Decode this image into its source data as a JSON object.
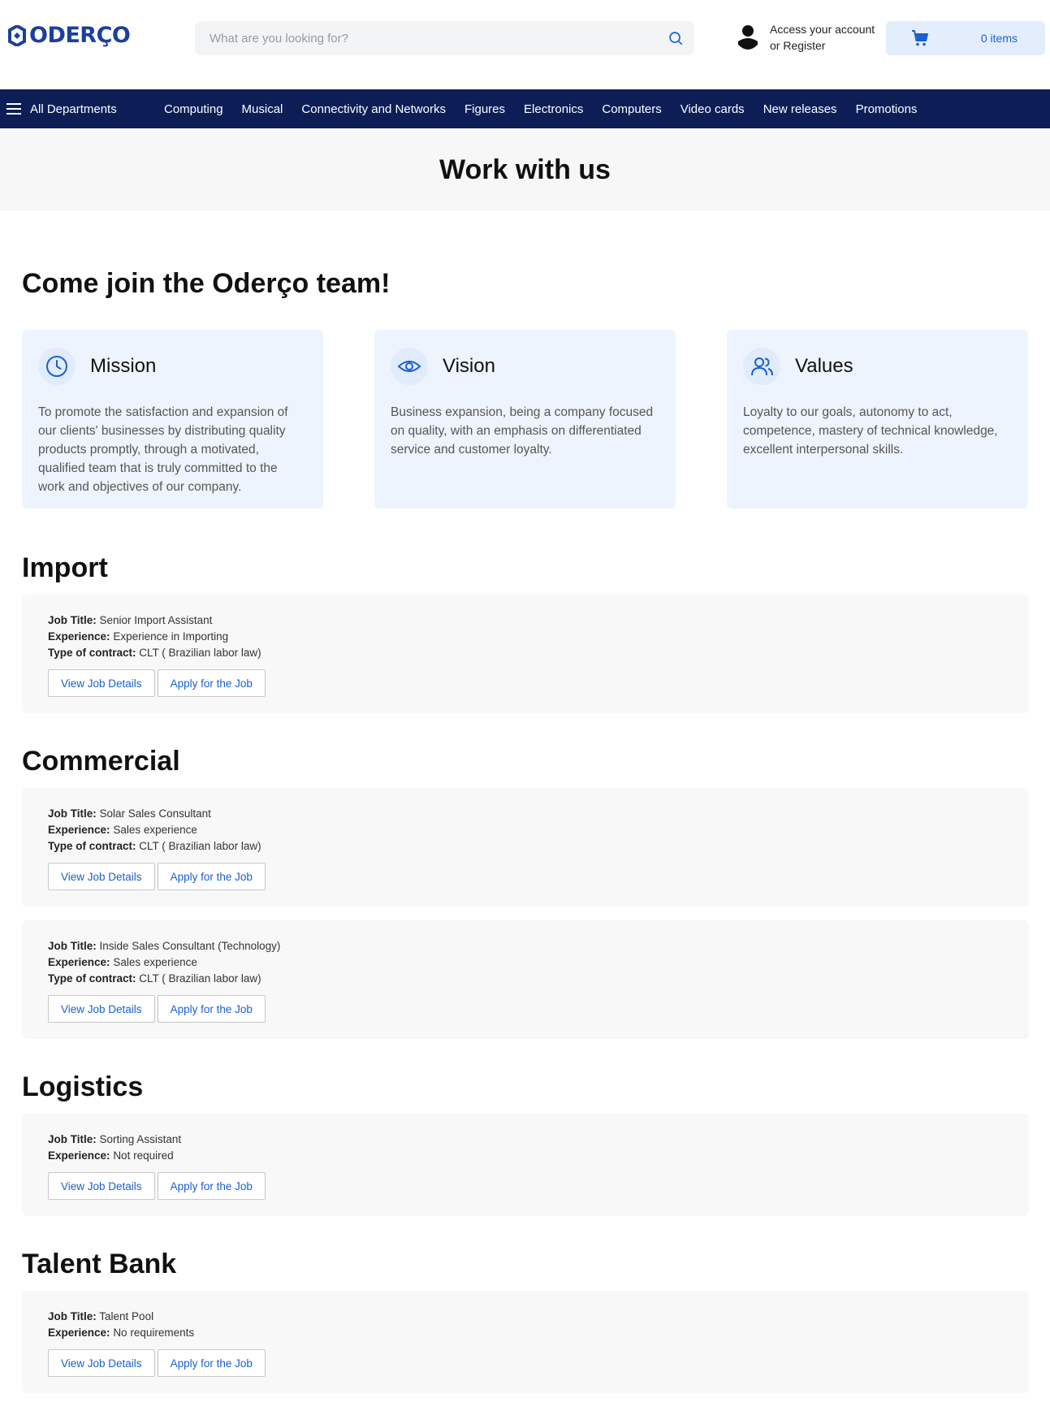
{
  "header": {
    "logo_text": "ODERÇO",
    "search_placeholder": "What are you looking for?",
    "account_line1": "Access your account",
    "account_line2": "or Register",
    "cart_count": "0 items"
  },
  "nav": {
    "all_departments": "All Departments",
    "items": [
      "Computing",
      "Musical",
      "Connectivity and Networks",
      "Figures",
      "Electronics",
      "Computers",
      "Video cards",
      "New releases",
      "Promotions"
    ]
  },
  "banner": {
    "title": "Work with us"
  },
  "intro": {
    "heading": "Come join the Oderço team!"
  },
  "cards": [
    {
      "title": "Mission",
      "icon": "clock-icon",
      "text": "To promote the satisfaction and expansion of our clients' businesses by distributing quality products promptly, through a motivated, qualified team that is truly committed to the work and objectives of our company."
    },
    {
      "title": "Vision",
      "icon": "eye-icon",
      "text": "Business expansion, being a company focused on quality, with an emphasis on differentiated service and customer loyalty."
    },
    {
      "title": "Values",
      "icon": "users-icon",
      "text": "Loyalty to our goals, autonomy to act, competence, mastery of technical knowledge, excellent interpersonal skills."
    }
  ],
  "labels": {
    "job_title": "Job Title:",
    "experience": "Experience:",
    "contract": "Type of contract:",
    "view_details": "View Job Details",
    "apply": "Apply for the Job"
  },
  "sections": [
    {
      "title": "Import",
      "jobs": [
        {
          "title": "Senior Import Assistant",
          "experience": "Experience in Importing",
          "contract": "CLT ( Brazilian labor law)"
        }
      ]
    },
    {
      "title": "Commercial",
      "jobs": [
        {
          "title": "Solar Sales Consultant",
          "experience": "Sales experience",
          "contract": "CLT ( Brazilian labor law)"
        },
        {
          "title": "Inside Sales Consultant (Technology)",
          "experience": "Sales experience",
          "contract": "CLT ( Brazilian labor law)"
        }
      ]
    },
    {
      "title": "Logistics",
      "jobs": [
        {
          "title": "Sorting Assistant",
          "experience": "Not required"
        }
      ]
    },
    {
      "title": "Talent Bank",
      "jobs": [
        {
          "title": "Talent Pool",
          "experience": "No requirements"
        }
      ]
    }
  ],
  "colors": {
    "brand": "#1b3fa0",
    "nav_bg": "#0d1e57",
    "link": "#1b5fd0",
    "card_bg": "#eef4fd"
  }
}
